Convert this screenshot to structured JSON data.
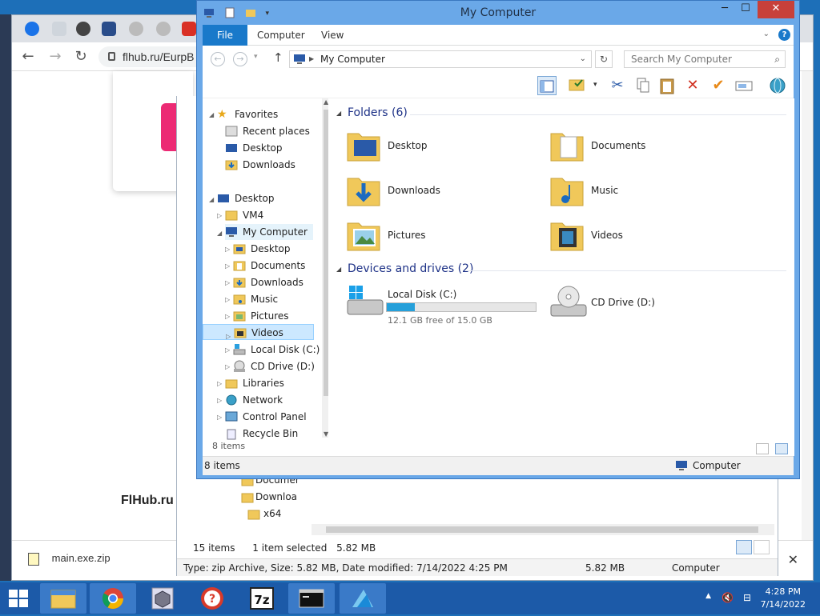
{
  "browser": {
    "url": "flhub.ru/EurpB",
    "brand_text": "FlHub.ru",
    "download_file": "main.exe.zip"
  },
  "bg_explorer": {
    "left_items": [
      "Documer",
      "Downloa",
      "x64"
    ],
    "items_count": "15 items",
    "selected": "1 item selected",
    "selected_size": "5.82 MB",
    "details": "Type: zip Archive, Size: 5.82 MB, Date modified: 7/14/2022 4:25 PM",
    "details_size": "5.82 MB",
    "details_location": "Computer"
  },
  "window": {
    "title": "My Computer",
    "ribbon_tabs": [
      "File",
      "Computer",
      "View"
    ],
    "address": "My Computer",
    "search_placeholder": "Search My Computer",
    "nav": {
      "favorites": "Favorites",
      "recent": "Recent places",
      "desktop": "Desktop",
      "downloads": "Downloads",
      "desktop_root": "Desktop",
      "vm4": "VM4",
      "my_computer": "My Computer",
      "sub": [
        "Desktop",
        "Documents",
        "Downloads",
        "Music",
        "Pictures",
        "Videos",
        "Local Disk (C:)",
        "CD Drive (D:)"
      ],
      "libraries": "Libraries",
      "network": "Network",
      "control_panel": "Control Panel",
      "recycle_bin": "Recycle Bin",
      "count": "8 items"
    },
    "folders_header": "Folders (6)",
    "folders": [
      "Desktop",
      "Documents",
      "Downloads",
      "Music",
      "Pictures",
      "Videos"
    ],
    "devices_header": "Devices and drives (2)",
    "drives": {
      "c_name": "Local Disk (C:)",
      "c_free": "12.1 GB free of 15.0 GB",
      "c_used_fraction": 0.19,
      "d_name": "CD Drive (D:)"
    },
    "status_count": "8 items",
    "status_location": "Computer"
  },
  "taskbar": {
    "time": "4:28 PM",
    "date": "7/14/2022"
  },
  "colors": {
    "accent": "#1979ca",
    "title_bg": "#6aa8e8",
    "close": "#c7403a",
    "taskbar": "#1c5aa8",
    "drive_fill": "#26a0da",
    "group_header": "#1e3287"
  }
}
